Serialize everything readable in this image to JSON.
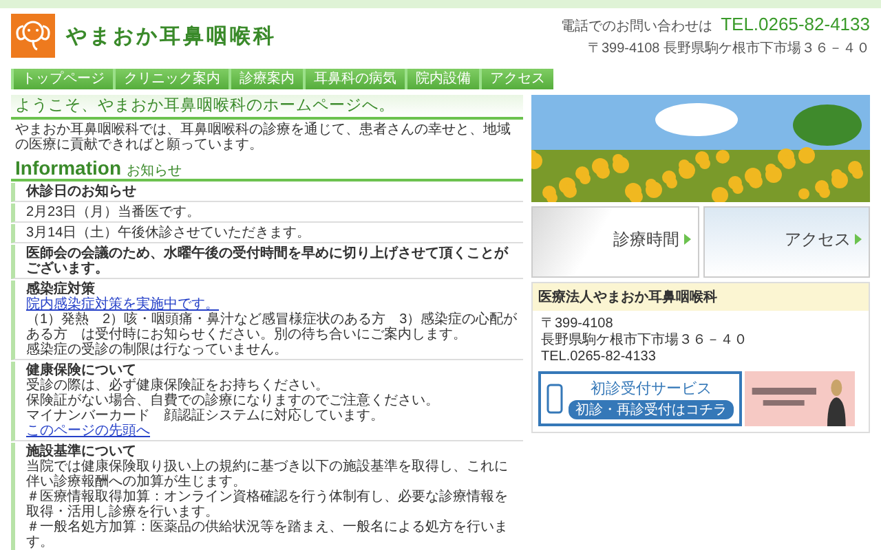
{
  "header": {
    "clinic_name": "やまおか耳鼻咽喉科",
    "contact_label": "電話でのお問い合わせは",
    "phone": "TEL.0265-82-4133",
    "address": "〒399-4108 長野県駒ケ根市下市場３６－４０"
  },
  "nav": [
    {
      "label": "トップページ"
    },
    {
      "label": "クリニック案内"
    },
    {
      "label": "診療案内"
    },
    {
      "label": "耳鼻科の病気"
    },
    {
      "label": "院内設備"
    },
    {
      "label": "アクセス"
    }
  ],
  "welcome": {
    "heading": "ようこそ、やまおか耳鼻咽喉科のホームページへ。",
    "text": "やまおか耳鼻咽喉科では、耳鼻咽喉科の診療を通じて、患者さんの幸せと、地域の医療に貢献できればと願っています。"
  },
  "information": {
    "heading": "Information",
    "subheading": "お知らせ",
    "items": [
      {
        "title": "休診日のお知らせ"
      },
      {
        "lines": [
          {
            "kind": "text",
            "text": "2月23日（月）当番医です。"
          }
        ]
      },
      {
        "lines": [
          {
            "kind": "text",
            "text": "3月14日（土）午後休診させていただきます。"
          }
        ]
      },
      {
        "title": "医師会の会議のため、水曜午後の受付時間を早めに切り上げさせて頂くことがございます。"
      },
      {
        "title": "感染症対策",
        "lines": [
          {
            "kind": "link",
            "text": "院内感染症対策を実施中です。"
          },
          {
            "kind": "text",
            "text": "（1）発熱　2）咳・咽頭痛・鼻汁など感冒様症状のある方　3）感染症の心配がある方　は受付時にお知らせください。別の待ち合いにご案内します。"
          },
          {
            "kind": "text",
            "text": "感染症の受診の制限は行なっていません。"
          }
        ]
      },
      {
        "title": "健康保険について",
        "lines": [
          {
            "kind": "text",
            "text": "受診の際は、必ず健康保険証をお持ちください。"
          },
          {
            "kind": "text",
            "text": "保険証がない場合、自費での診療になりますのでご注意ください。"
          },
          {
            "kind": "text",
            "text": "マイナンバーカード　顔認証システムに対応しています。"
          },
          {
            "kind": "link",
            "text": "このページの先頭へ"
          }
        ]
      },
      {
        "title": "施設基準について",
        "lines": [
          {
            "kind": "text",
            "text": "当院では健康保険取り扱い上の規約に基づき以下の施設基準を取得し、これに伴い診療報酬への加算が生じます。"
          },
          {
            "kind": "text",
            "text": "＃医療情報取得加算：オンライン資格確認を行う体制有し、必要な診療情報を取得・活用し診療を行います。"
          },
          {
            "kind": "text",
            "text": "＃一般名処方加算：医薬品の供給状況等を踏まえ、一般名による処方を行います。"
          }
        ]
      }
    ]
  },
  "side": {
    "banners": [
      {
        "label": "診療時間",
        "kind": "hours"
      },
      {
        "label": "アクセス",
        "kind": "access"
      }
    ],
    "clinic_box": {
      "title": "医療法人やまおか耳鼻咽喉科",
      "lines": [
        "〒399-4108",
        "長野県駒ケ根市下市場３６－４０",
        "TEL.0265-82-4133"
      ],
      "service_title": "初診受付サービス",
      "service_button": "初診・再診受付はコチラ"
    }
  }
}
